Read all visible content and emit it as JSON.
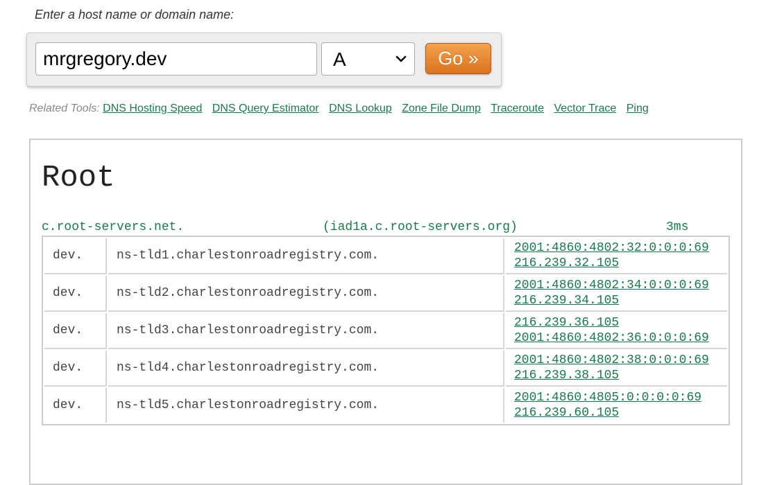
{
  "form": {
    "prompt": "Enter a host name or domain name:",
    "host_value": "mrgregory.dev",
    "record_type": "A",
    "go_label": "Go »"
  },
  "related_tools": {
    "label": "Related Tools:",
    "links": [
      "DNS Hosting Speed",
      "DNS Query Estimator",
      "DNS Lookup",
      "Zone File Dump",
      "Traceroute",
      "Vector Trace",
      "Ping"
    ]
  },
  "results": {
    "section_title": "Root",
    "server": {
      "name": "c.root-servers.net.",
      "instance": "(iad1a.c.root-servers.org)",
      "time": "3ms"
    },
    "records": [
      {
        "zone": "dev.",
        "ns": "ns-tld1.charlestonroadregistry.com.",
        "ips": [
          "2001:4860:4802:32:0:0:0:69",
          "216.239.32.105"
        ]
      },
      {
        "zone": "dev.",
        "ns": "ns-tld2.charlestonroadregistry.com.",
        "ips": [
          "2001:4860:4802:34:0:0:0:69",
          "216.239.34.105"
        ]
      },
      {
        "zone": "dev.",
        "ns": "ns-tld3.charlestonroadregistry.com.",
        "ips": [
          "216.239.36.105",
          "2001:4860:4802:36:0:0:0:69"
        ]
      },
      {
        "zone": "dev.",
        "ns": "ns-tld4.charlestonroadregistry.com.",
        "ips": [
          "2001:4860:4802:38:0:0:0:69",
          "216.239.38.105"
        ]
      },
      {
        "zone": "dev.",
        "ns": "ns-tld5.charlestonroadregistry.com.",
        "ips": [
          "2001:4860:4805:0:0:0:0:69",
          "216.239.60.105"
        ]
      }
    ]
  },
  "colors": {
    "link": "#1a7a4c",
    "go_button": "#e8892f"
  }
}
